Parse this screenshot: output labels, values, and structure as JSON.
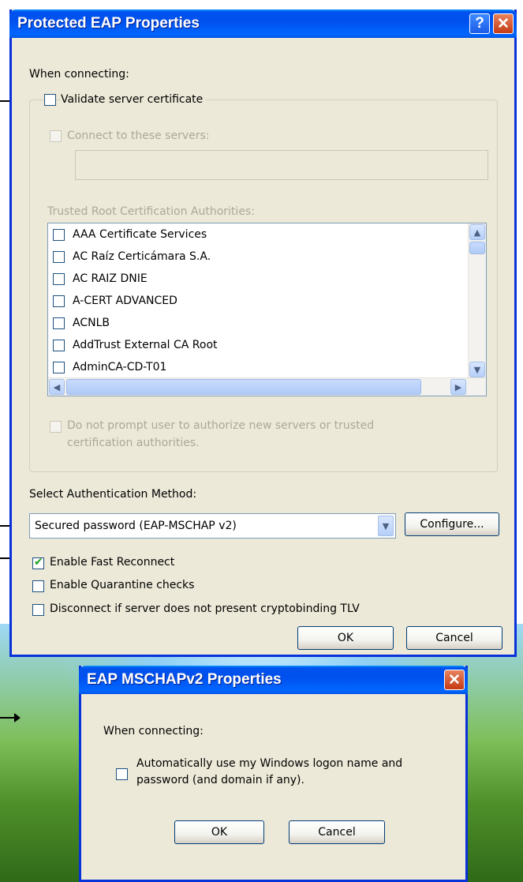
{
  "peap": {
    "title": "Protected EAP Properties",
    "help_glyph": "?",
    "close_glyph": "✕",
    "when_connecting": "When connecting:",
    "validate_cert": "Validate server certificate",
    "connect_servers": "Connect to these servers:",
    "connect_servers_value": "",
    "trusted_root": "Trusted Root Certification Authorities:",
    "ca_list": [
      "AAA Certificate Services",
      "AC Raíz Certicámara S.A.",
      "AC RAIZ DNIE",
      "A-CERT ADVANCED",
      "ACNLB",
      "AddTrust External CA Root",
      "AdminCA-CD-T01"
    ],
    "no_prompt_line1": "Do not prompt user to authorize new servers or trusted",
    "no_prompt_line2": "certification authorities.",
    "select_method": "Select Authentication Method:",
    "method_value": "Secured password (EAP-MSCHAP v2)",
    "configure": "Configure...",
    "fast_reconnect": "Enable Fast Reconnect",
    "fast_reconnect_checked": true,
    "quarantine": "Enable Quarantine checks",
    "cryptobinding": "Disconnect if server does not present cryptobinding TLV",
    "ok": "OK",
    "cancel": "Cancel"
  },
  "mschap": {
    "title": "EAP MSCHAPv2 Properties",
    "close_glyph": "✕",
    "when_connecting": "When connecting:",
    "auto_logon_line1": "Automatically use my Windows logon name and",
    "auto_logon_line2": "password (and domain if any).",
    "ok": "OK",
    "cancel": "Cancel"
  },
  "icons": {
    "scroll_up": "▲",
    "scroll_down": "▼",
    "scroll_left": "◀",
    "scroll_right": "▶",
    "dropdown": "▼",
    "check": "✔"
  },
  "colors": {
    "titlebar": "#0055e5",
    "window_face": "#ece9d8",
    "close_button": "#c53a13"
  }
}
